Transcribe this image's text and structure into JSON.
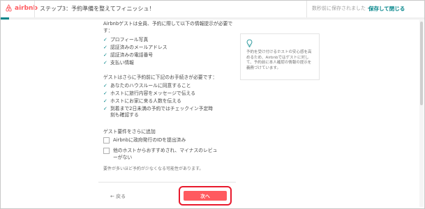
{
  "header": {
    "brand": "airbnb",
    "step_title": "ステップ3：予約準備を整えてフィニッシュ！",
    "saved_note": "数秒前に保存されました・",
    "save_close": "保存して閉じる"
  },
  "progress": {
    "fraction": 0.02
  },
  "main": {
    "intro": "Airbnbゲストは全員、予約に際して以下の情報提示が必要です：",
    "requirements": [
      "プロフィール写真",
      "認証済みのメールアドレス",
      "認証済みの電話番号",
      "支払い情報"
    ],
    "extra_heading": "ゲストはさらに予約前に下記のお手続きが必要です：",
    "extra_requirements": [
      "あなたのハウスルールに同意すること",
      "ホストに旅行内容をメッセージで伝える",
      "ホストにお家に来る人数を伝える",
      "到着まで2日未満の予約ではチェックイン予定時",
      "刻も確認する"
    ],
    "additional_heading": "ゲスト要件をさらに追加",
    "options": [
      {
        "label": "Airbnbに政府発行のIDを提出済み"
      },
      {
        "label_line1": "他のホストからおすすめされ、マイナスのレビュ",
        "label_line2": "ーがない"
      }
    ],
    "note": "要件が多いほど予約が少なくなる可能性があります。"
  },
  "footer": {
    "back_label": "← 戻る",
    "next_label": "次へ"
  },
  "tip": {
    "icon": "lightbulb-icon",
    "text": "予約を受け付けるホストの安心感を高めるため、Airbnbではゲストに対して、予約前に本人確認の情報の提示を義務づけています。"
  },
  "colors": {
    "brand": "#ff5a5f",
    "accent": "#008489",
    "highlight": "#e8192c"
  }
}
